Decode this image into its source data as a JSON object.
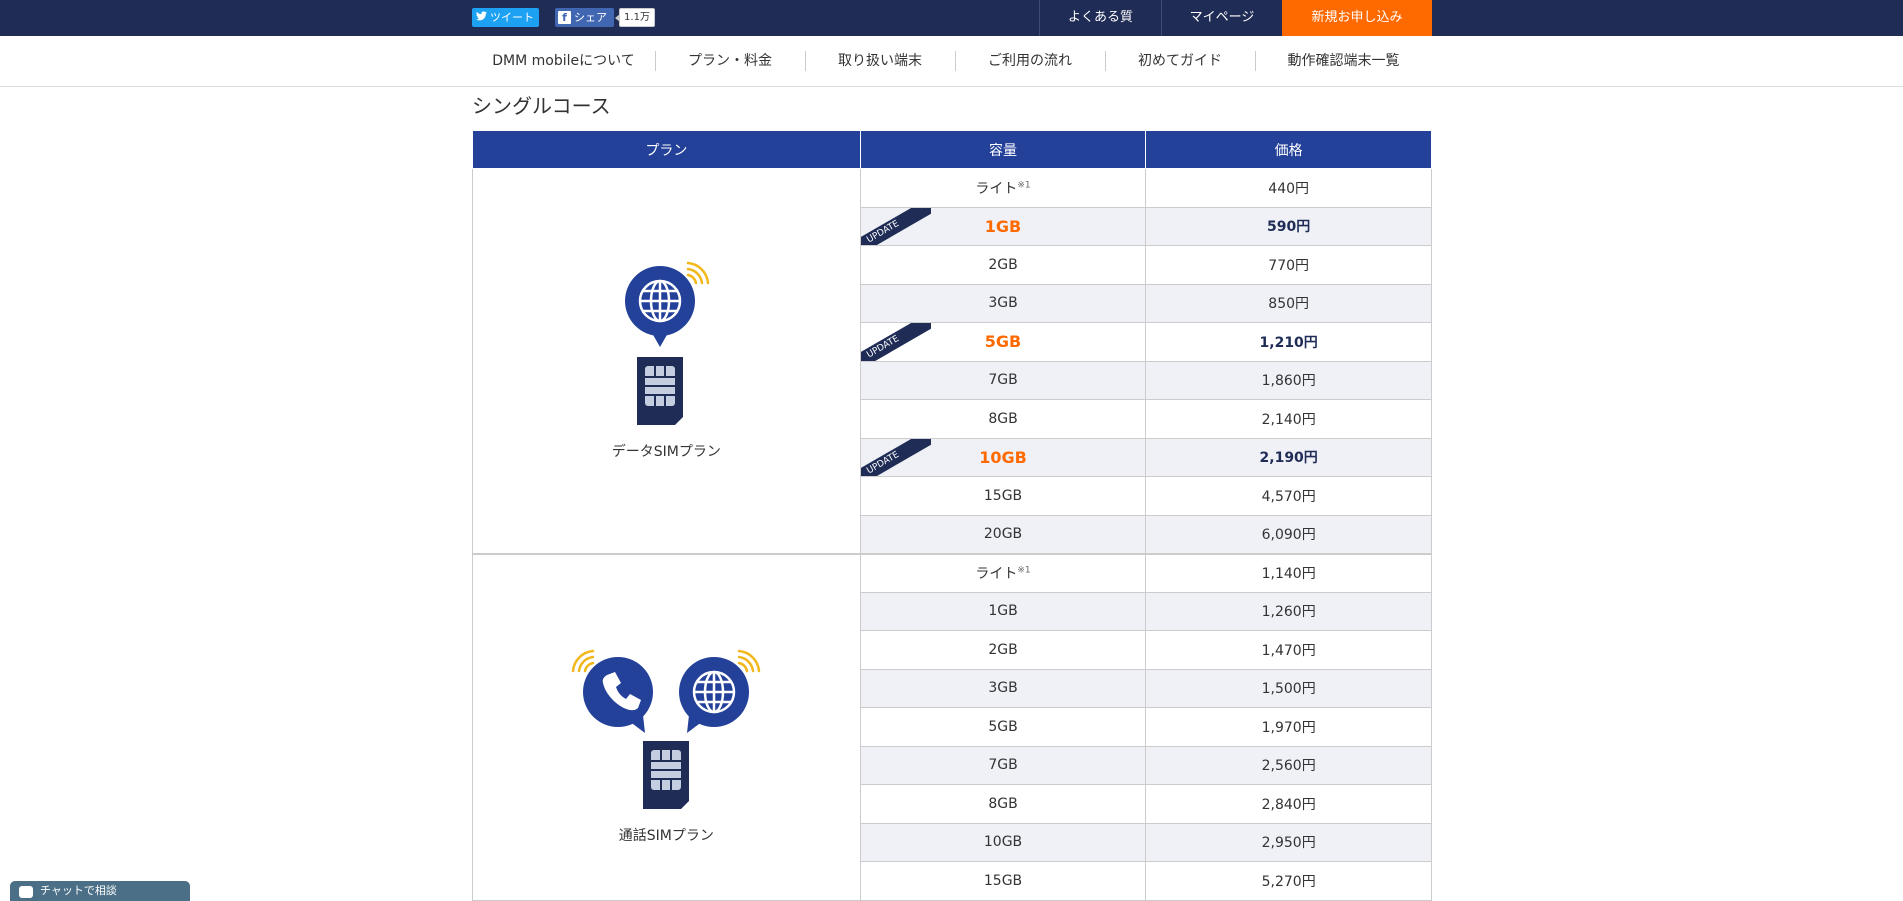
{
  "topbar": {
    "tweet_label": "ツイート",
    "share_label": "シェア",
    "share_count": "1.1万",
    "faq_label": "よくある質問",
    "mypage_label": "マイページ",
    "apply_label": "新規お申し込み"
  },
  "subnav": {
    "items": [
      {
        "label": "DMM mobileについて"
      },
      {
        "label": "プラン・料金"
      },
      {
        "label": "取り扱い端末"
      },
      {
        "label": "ご利用の流れ"
      },
      {
        "label": "初めてガイド"
      },
      {
        "label": "動作確認端末一覧"
      }
    ]
  },
  "section_title": "シングルコース",
  "table": {
    "headers": {
      "plan": "プラン",
      "capacity": "容量",
      "price": "価格"
    },
    "ribbon_label": "UPDATE",
    "note_mark": "※1",
    "data_plan": {
      "name": "データSIMプラン",
      "rows": [
        {
          "capacity": "ライト",
          "price": "440円"
        },
        {
          "capacity": "1GB",
          "price": "590円"
        },
        {
          "capacity": "2GB",
          "price": "770円"
        },
        {
          "capacity": "3GB",
          "price": "850円"
        },
        {
          "capacity": "5GB",
          "price": "1,210円"
        },
        {
          "capacity": "7GB",
          "price": "1,860円"
        },
        {
          "capacity": "8GB",
          "price": "2,140円"
        },
        {
          "capacity": "10GB",
          "price": "2,190円"
        },
        {
          "capacity": "15GB",
          "price": "4,570円"
        },
        {
          "capacity": "20GB",
          "price": "6,090円"
        }
      ]
    },
    "voice_plan": {
      "name": "通話SIMプラン",
      "rows": [
        {
          "capacity": "ライト",
          "price": "1,140円"
        },
        {
          "capacity": "1GB",
          "price": "1,260円"
        },
        {
          "capacity": "2GB",
          "price": "1,470円"
        },
        {
          "capacity": "3GB",
          "price": "1,500円"
        },
        {
          "capacity": "5GB",
          "price": "1,970円"
        },
        {
          "capacity": "7GB",
          "price": "2,560円"
        },
        {
          "capacity": "8GB",
          "price": "2,840円"
        },
        {
          "capacity": "10GB",
          "price": "2,950円"
        },
        {
          "capacity": "15GB",
          "price": "5,270円"
        }
      ]
    }
  },
  "chat_widget": {
    "label": "チャットで相談"
  },
  "colors": {
    "navy": "#1f2c55",
    "header_blue": "#24419a",
    "orange": "#ff6a00",
    "row_alt": "#eff1f7",
    "signal_yellow": "#f2b81b"
  }
}
